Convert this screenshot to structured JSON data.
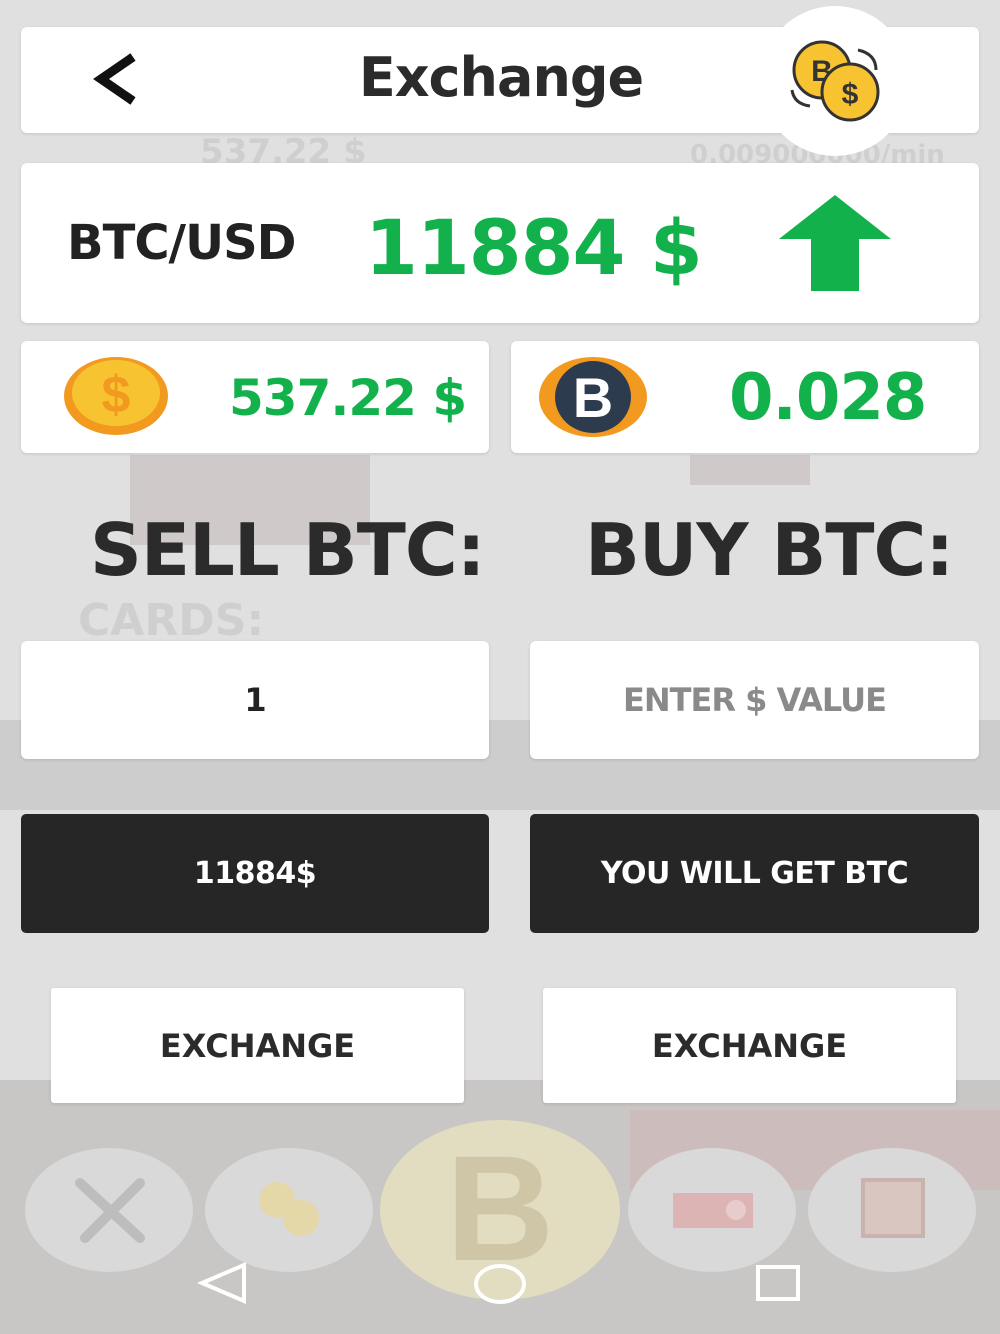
{
  "header": {
    "title": "Exchange",
    "back_icon": "chevron-left-icon",
    "exchange_icon": "coin-exchange-icon"
  },
  "rate": {
    "pair": "BTC/USD",
    "value": "11884 $",
    "trend": "up",
    "trend_color": "#12b14b"
  },
  "balances": {
    "usd": "537.22 $",
    "btc": "0.028"
  },
  "sell": {
    "heading": "SELL BTC:",
    "input_value": "1",
    "result": "11884$",
    "exchange_label": "EXCHANGE"
  },
  "buy": {
    "heading": "BUY BTC:",
    "input_placeholder": "ENTER $ VALUE",
    "result": "YOU WILL GET BTC",
    "exchange_label": "EXCHANGE"
  },
  "background": {
    "ghost_usd": "537.22 $",
    "ghost_rate": "0.009000000/min",
    "ghost_cards": "CARDS:"
  },
  "bottom_nav": [
    {
      "name": "tools",
      "icon": "tools-icon"
    },
    {
      "name": "exchange",
      "icon": "coin-exchange-icon"
    },
    {
      "name": "bitcoin",
      "icon": "bitcoin-icon"
    },
    {
      "name": "gpu",
      "icon": "gpu-card-icon"
    },
    {
      "name": "library",
      "icon": "books-icon"
    }
  ],
  "colors": {
    "green": "#12b14b",
    "dark": "#262626",
    "coin_gold": "#f7c331",
    "coin_orange": "#f29a1f"
  }
}
